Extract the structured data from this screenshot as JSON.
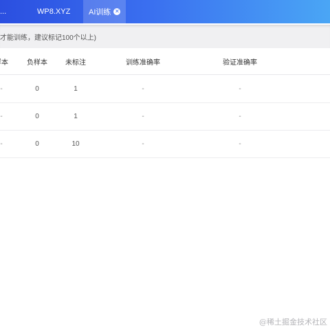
{
  "tabs": [
    {
      "label": "..."
    },
    {
      "label": "WP8.XYZ"
    },
    {
      "label": "AI训练"
    }
  ],
  "notice": "才能训练，建议标记100个以上)",
  "table": {
    "headers": [
      "样本",
      "负样本",
      "未标注",
      "训练准确率",
      "验证准确率"
    ],
    "rows": [
      [
        "-",
        "0",
        "1",
        "-",
        "-"
      ],
      [
        "-",
        "0",
        "1",
        "-",
        "-"
      ],
      [
        "-",
        "0",
        "10",
        "-",
        "-"
      ]
    ]
  },
  "watermark": "@稀土掘金技术社区",
  "colors": {
    "topbar_start": "#2b4fe0",
    "topbar_end": "#4aa6f5"
  }
}
